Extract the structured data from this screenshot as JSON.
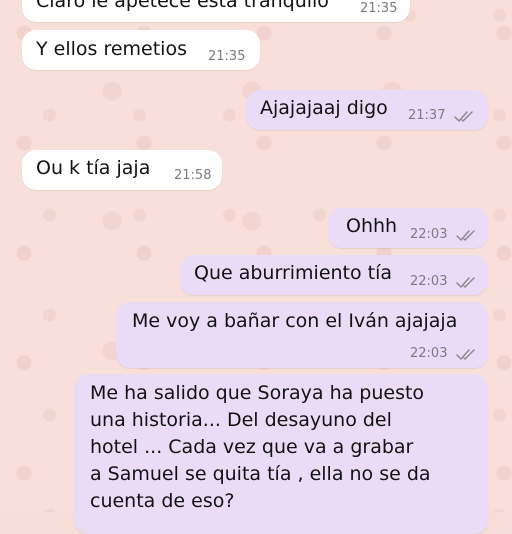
{
  "messages": [
    {
      "direction": "in",
      "text": "Claro le apetece esta tranquilo",
      "time": "21:35"
    },
    {
      "direction": "in",
      "text": "Y ellos remetios",
      "time": "21:35"
    },
    {
      "direction": "out",
      "text": "Ajajajaaj digo",
      "time": "21:37",
      "status": "double-check-icon"
    },
    {
      "direction": "in",
      "text": "Ou k tía jaja",
      "time": "21:58"
    },
    {
      "direction": "out",
      "text": "Ohhh",
      "time": "22:03",
      "status": "double-check-icon"
    },
    {
      "direction": "out",
      "text": "Que aburrimiento tía",
      "time": "22:03",
      "status": "double-check-icon"
    },
    {
      "direction": "out",
      "text": "Me voy a bañar con el Iván ajajaja",
      "time": "22:03",
      "status": "double-check-icon"
    },
    {
      "direction": "out",
      "lines": [
        "Me ha salido que Soraya ha puesto",
        "una historia... Del desayuno del",
        "hotel ... Cada vez que va a grabar",
        "a Samuel se quita tía , ella no se da",
        "cuenta de eso?"
      ]
    }
  ],
  "colors": {
    "incoming_bubble": "#ffffff",
    "outgoing_bubble": "#eadcf6",
    "wallpaper": "#f8dfd9",
    "timestamp": "#7a7a80"
  }
}
